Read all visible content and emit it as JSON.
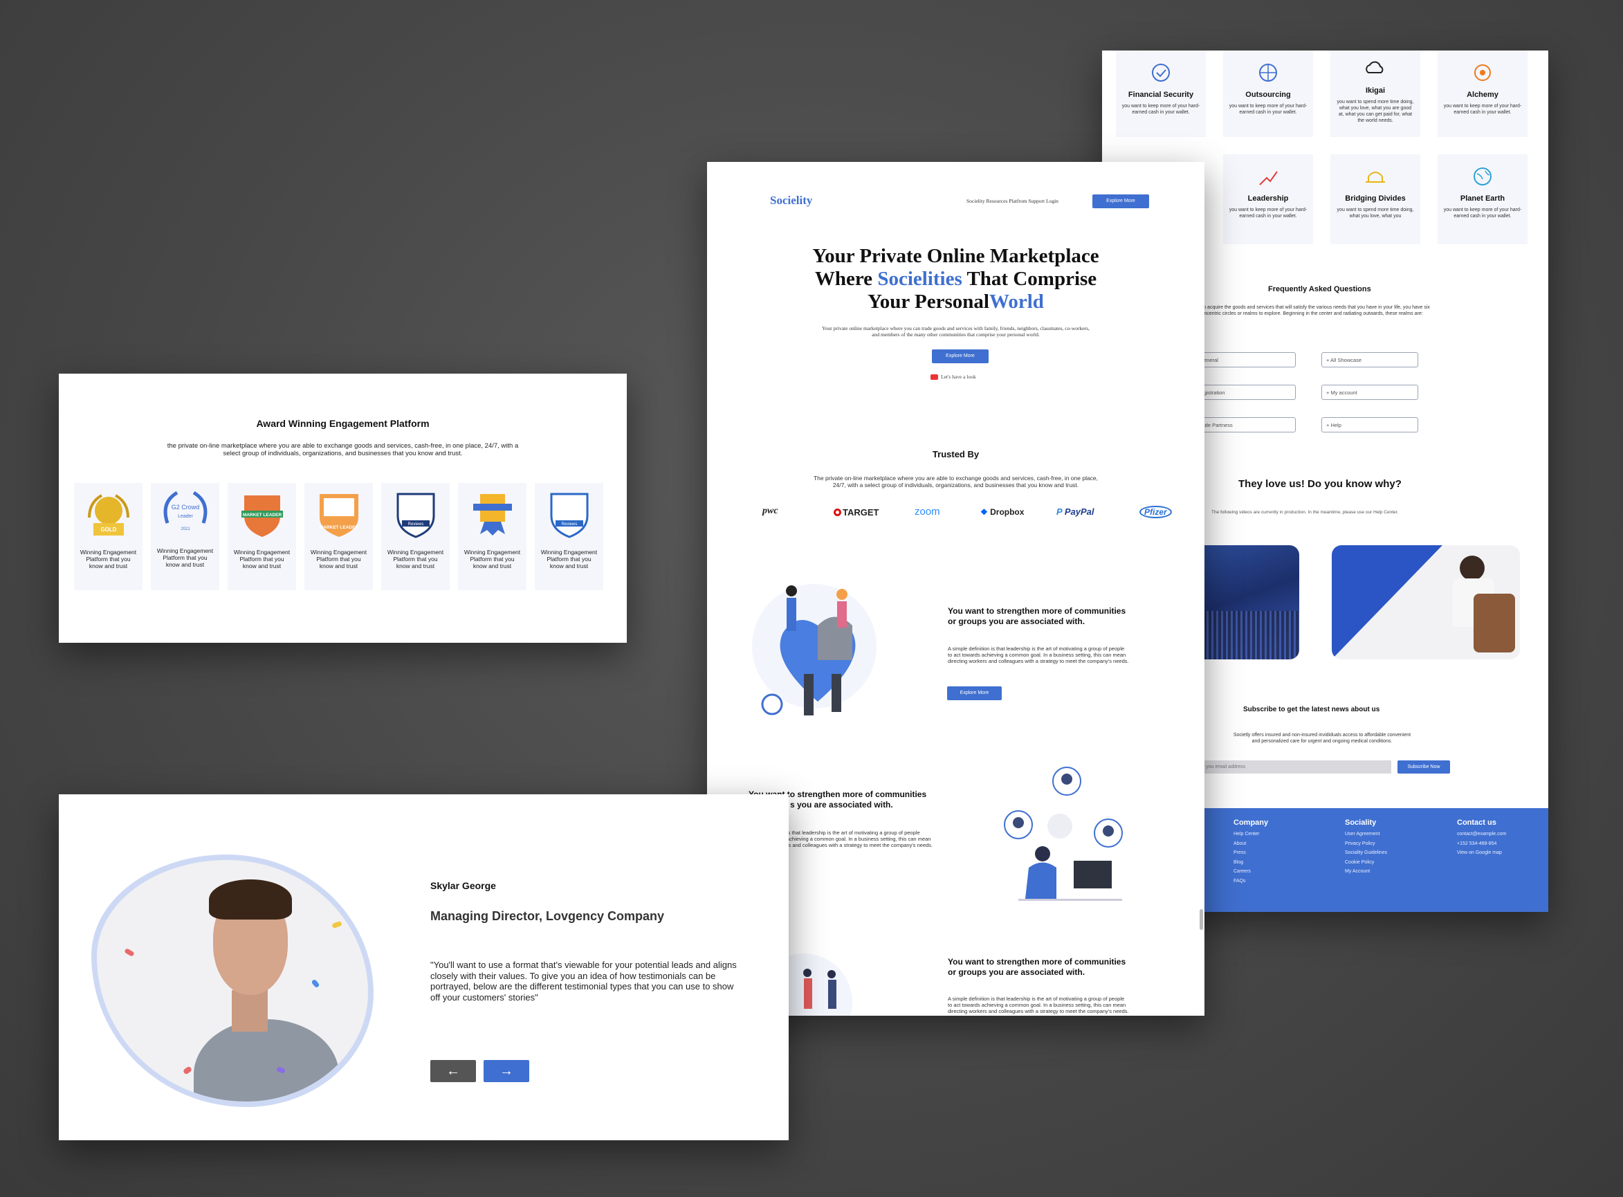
{
  "back": {
    "categories_row1": [
      {
        "title": "Financial Security",
        "desc": "you want to keep more of your hard-earned cash in your wallet."
      },
      {
        "title": "Outsourcing",
        "desc": "you want to keep more of your hard-earned cash in your wallet."
      },
      {
        "title": "Ikigai",
        "desc": "you want to spend more time doing, what you love, what you are good at, what you can get paid for, what the world needs."
      },
      {
        "title": "Alchemy",
        "desc": "you want to keep more of your hard-earned cash in your wallet."
      }
    ],
    "categories_row2": [
      {
        "title": "Leadership",
        "desc": "you want to keep more of your hard-earned cash in your wallet."
      },
      {
        "title": "Bridging Divides",
        "desc": "you want to spend more time doing, what you love, what you"
      },
      {
        "title": "Planet Earth",
        "desc": "you want to keep more of your hard-earned cash in your wallet."
      }
    ],
    "faq_title": "Frequently Asked Questions",
    "faq_desc_1": "r to acquire the goods and services that will satisfy the various needs that you have in your life, you have six",
    "faq_desc_2": "concentric circles or realms to explore. Beginning in the center and radiating outwards, these realms are:",
    "faq_left": [
      "eneral",
      "gistration",
      "ide Partness"
    ],
    "faq_right": [
      "+ All Showcase",
      "+ My account",
      "+ Help"
    ],
    "love_title": "They love us! Do you know why?",
    "love_desc": "The following videos are currently in production. In the meantime, please use our Help Center.",
    "subscribe_title": "Subscribe to get the latest news about us",
    "subscribe_desc_1": "Societly offers insured and non-insured invididuals access to affordable convenient",
    "subscribe_desc_2": "and personalized care for urgent and ongoing medical conditions.",
    "email_placeholder": "r you email address",
    "subscribe_btn": "Subscribe Now",
    "footer": {
      "company_h": "Company",
      "company_links": [
        "Help Center",
        "About",
        "Press",
        "Blog",
        "Careers",
        "FAQs"
      ],
      "sociality_h": "Sociality",
      "sociality_links": [
        "User Agreement",
        "Privacy Policy",
        "Sociality Guidelines",
        "Cookie Policy",
        "My Account"
      ],
      "contact_h": "Contact us",
      "contact_links": [
        "contact@example.com",
        "+152 534-468-854",
        "View on Google map"
      ]
    }
  },
  "award": {
    "title": "Award Winning Engagement Platform",
    "desc_1": "the private on-line marketplace where you are able to exchange goods and services, cash-free, in one place, 24/7, with a",
    "desc_2": "select group of individuals, organizations, and businesses that you know and trust.",
    "badges": [
      {
        "l1": "Winning Engagement",
        "l2": "Platform that you",
        "l3": "know and trust"
      },
      {
        "l1": "Winning Engagement",
        "l2": "Platform that you",
        "l3": "know and trust"
      },
      {
        "l1": "Winning Engagement",
        "l2": "Platform that you",
        "l3": "know and trust"
      },
      {
        "l1": "Winning Engagement",
        "l2": "Platform that you",
        "l3": "know and trust"
      },
      {
        "l1": "Winning Engagement",
        "l2": "Platform that you",
        "l3": "know and trust"
      },
      {
        "l1": "Winning Engagement",
        "l2": "Platform that you",
        "l3": "know and trust"
      },
      {
        "l1": "Winning Engagement",
        "l2": "Platform that you",
        "l3": "know and trust"
      }
    ],
    "badge_texts": [
      "GOLD",
      "G2 Crowd",
      "Leader",
      "2021",
      "MARKET LEADER",
      "MARKET LEADER",
      "Reviews",
      "Reviews"
    ]
  },
  "main": {
    "brand": "Socielity",
    "nav": "Socielity Resources Platfrom Support Login",
    "nav_btn": "Explore More",
    "hero_l1": "Your Private Online Marketplace",
    "hero_l2a": "Where ",
    "hero_l2b": "Socielities",
    "hero_l2c": " That Comprise",
    "hero_l3a": "Your Personal",
    "hero_l3b": "World",
    "hero_desc_1": "Your private online marketplace where you can trade goods and services with family, friends, neighbors, classmates, co-workers,",
    "hero_desc_2": "and members of the many other communities that comprise your personal world.",
    "hero_btn": "Explore More",
    "video_link": "Let's have a look",
    "trusted_title": "Trusted By",
    "trusted_desc_1": "The private on-line marketplace where you are able to exchange goods and services, cash-free, in one place,",
    "trusted_desc_2": "24/7, with a select group of individuals, organizations, and businesses that you know and trust.",
    "logos": [
      "pwc",
      "TARGET",
      "zoom",
      "Dropbox",
      "PayPal",
      "Pfizer"
    ],
    "feature1_title_1": "You want to strengthen more of communities",
    "feature1_title_2": "or groups you are associated with.",
    "feature1_desc_1": "A simple definition is that leadership is the art of motivating a group of people",
    "feature1_desc_2": "to act towards achieving a common goal. In a business setting, this can mean",
    "feature1_desc_3": "directing workers and colleagues with a strategy to meet the company's needs.",
    "feature1_btn": "Explore More",
    "feature2_title_1": "You want to strengthen more of communities",
    "feature2_title_2": "s you are associated with.",
    "feature2_desc_1": "is that leadership is the art of motivating a group of people",
    "feature2_desc_2": "achieving a common goal. In a business setting, this can mean",
    "feature2_desc_3": "rs and colleagues with a strategy to meet the company's needs.",
    "feature3_title_1": "You want to strengthen more of communities",
    "feature3_title_2": "or groups you are associated with.",
    "feature3_desc_1": "A simple definition is that leadership is the art of motivating a group of people",
    "feature3_desc_2": "to act towards achieving a common goal. In a business setting, this can mean",
    "feature3_desc_3": "directing workers and colleagues with a strategy to meet the company's needs."
  },
  "testimonial": {
    "name": "Skylar George",
    "role": "Managing Director, Lovgency Company",
    "quote_1": "\"You'll want to use a format that's viewable for your potential leads and aligns",
    "quote_2": "closely with their values. To give you an idea of how testimonials can be",
    "quote_3": "portrayed, below are the different testimonial types that you can use to show",
    "quote_4": "off your customers' stories\"",
    "prev": "←",
    "next": "→"
  },
  "colors": {
    "accent": "#3f6fd0",
    "background": "#474747"
  }
}
